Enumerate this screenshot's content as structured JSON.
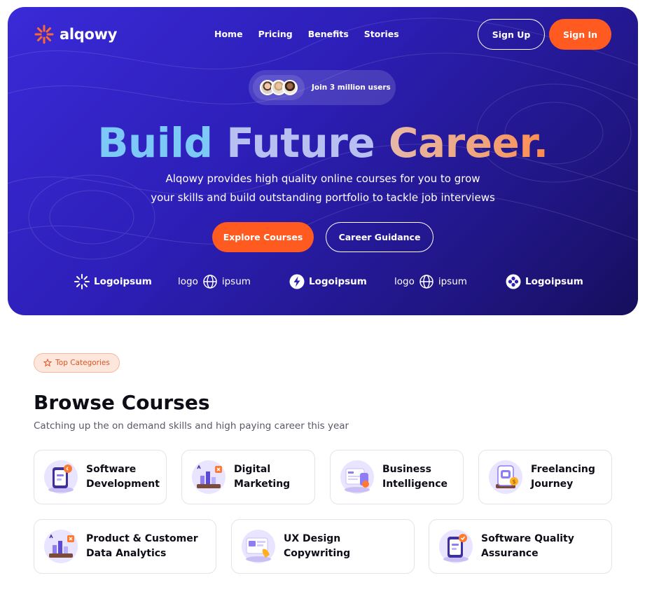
{
  "brand": {
    "name": "alqowy",
    "accent": "#ff5a1f",
    "hero_bg": "#2d1fb8"
  },
  "nav": {
    "items": [
      {
        "label": "Home"
      },
      {
        "label": "Pricing"
      },
      {
        "label": "Benefits"
      },
      {
        "label": "Stories"
      }
    ],
    "signup_label": "Sign Up",
    "signin_label": "Sign In"
  },
  "hero": {
    "users_text": "Join 3 million users",
    "headline": {
      "word1": "Build",
      "word2": "Future",
      "word3": "Career."
    },
    "subtitle_line1": "Alqowy provides high quality online courses for you to grow",
    "subtitle_line2": "your skills and build outstanding portfolio to tackle job interviews",
    "explore_label": "Explore Courses",
    "guidance_label": "Career Guidance",
    "partners": [
      {
        "label": "Logoipsum",
        "icon": "sunburst-icon"
      },
      {
        "label": "logo",
        "label2": "ipsum",
        "icon": "globe-icon"
      },
      {
        "label": "Logoipsum",
        "icon": "bolt-icon"
      },
      {
        "label": "logo",
        "label2": "ipsum",
        "icon": "globe-icon"
      },
      {
        "label": "Logoipsum",
        "icon": "clover-icon"
      }
    ]
  },
  "categories": {
    "badge": "Top Categories",
    "title": "Browse Courses",
    "subtitle": "Catching up the on demand skills and high paying career this year",
    "items": [
      {
        "label": "Software\nDevelopment",
        "icon": "phone-code-icon"
      },
      {
        "label": "Digital\nMarketing",
        "icon": "bar-chart-icon"
      },
      {
        "label": "Business\nIntelligence",
        "icon": "dashboard-icon"
      },
      {
        "label": "Freelancing\nJourney",
        "icon": "phone-coin-icon"
      },
      {
        "label": "Product & Customer\nData Analytics",
        "icon": "analytics-icon"
      },
      {
        "label": "UX Design\nCopywriting",
        "icon": "design-hand-icon"
      },
      {
        "label": "Software Quality\nAssurance",
        "icon": "phone-check-icon"
      }
    ]
  }
}
